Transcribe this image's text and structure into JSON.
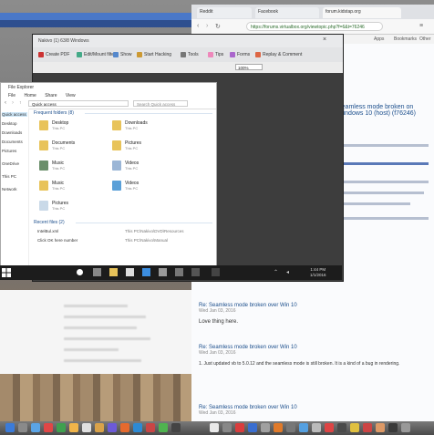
{
  "rdp": {
    "title": "Nakivo (1) 63/8 Windows",
    "toolbar": [
      "Create PDF",
      "Edit/Mount filter",
      "Show",
      "Start Hacking",
      "Tools",
      "Tips",
      "Forms",
      "Replay & Comment"
    ],
    "zoom": "100%"
  },
  "explorer": {
    "title": "File Explorer",
    "ribbon": [
      "File",
      "Home",
      "Share",
      "View"
    ],
    "path": "Quick access",
    "search_placeholder": "Search Quick access",
    "nav": [
      "Quick access",
      "Desktop",
      "Downloads",
      "Documents",
      "Pictures",
      "OneDrive",
      "This PC",
      "Network"
    ],
    "frequent_header": "Frequent folders (8)",
    "folders": [
      {
        "name": "Desktop",
        "sub": "This PC"
      },
      {
        "name": "Downloads",
        "sub": "This PC"
      },
      {
        "name": "Documents",
        "sub": "This PC"
      },
      {
        "name": "Pictures",
        "sub": "This PC"
      },
      {
        "name": "Music",
        "sub": "This PC"
      },
      {
        "name": "Videos",
        "sub": "This PC"
      },
      {
        "name": "Music",
        "sub": "This PC"
      },
      {
        "name": "Videos",
        "sub": "This PC"
      },
      {
        "name": "Pictures",
        "sub": "This PC"
      }
    ],
    "recent_header": "Recent files (2)",
    "recent": [
      {
        "name": "IntelBul.xml",
        "loc": "This PC\\Nakivo\\DVD\\Resources"
      },
      {
        "name": "Click OK here number",
        "loc": "This PC\\Nakivo\\Manual"
      }
    ]
  },
  "taskbar": {
    "time": "1:44 PM",
    "date": "1/1/2016"
  },
  "browser": {
    "tabs": [
      "Reddit",
      "Facebook",
      "forum.kidstap.org"
    ],
    "address": "https://forums.virtualbox.org/viewtopic.php?f=6&t=76246",
    "bookmarks": [
      "Apps",
      "Bookmarks",
      "Other"
    ],
    "thread_title": "Seamless mode broken on Windows 10 (host) (f76246)",
    "thread_sub": "(f76246)",
    "posts": [
      {
        "header": "Re: Seamless mode broken over Win 10",
        "date": "Wed Jan 03, 2016",
        "body": "Love thing here."
      },
      {
        "header": "Re: Seamless mode broken over Win 10",
        "date": "Wed Jan 03, 2016",
        "body": "1. Just updated vb to 5.0.12 and the seamless mode is still broken. It is a kind of a bug in rendering."
      },
      {
        "header": "Re: Seamless mode broken over Win 10",
        "date": "Wed Jan 03, 2016",
        "body": ""
      }
    ],
    "tag": "Seamless"
  }
}
